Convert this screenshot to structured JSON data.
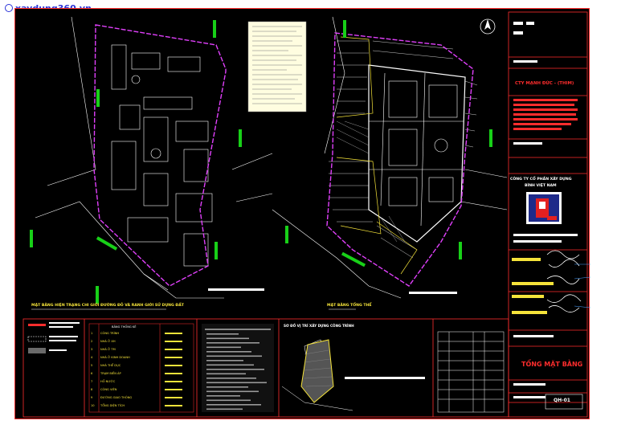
{
  "watermark": {
    "text": "xaydung360.vn",
    "icon": "circle-arrow-icon",
    "color": "#2a33d8"
  },
  "drawing": {
    "title_left": "MẶT BẰNG HIỆN TRẠNG CHI GIỚI ĐƯỜNG ĐỎ VÀ RANH GIỚI SỬ DỤNG ĐẤT",
    "title_right": "MẶT BẰNG TỔNG THỂ",
    "north_arrow": "north-arrow-icon"
  },
  "title_block": {
    "company": "CTY MẠNH ĐỨC - (THIM)",
    "designer": "CÔNG TY CỔ PHẦN XÂY DỰNG",
    "designer_line2": "BÌNH VIỆT NAM",
    "sheet_title": "TỔNG MẶT BẰNG",
    "sheet_no": "QH-01"
  },
  "legend_table": {
    "header": "BẢNG THỐNG KÊ",
    "rows": [
      {
        "no": "1",
        "name": "CÔNG TRÌNH"
      },
      {
        "no": "2",
        "name": "NHÀ Ở XH"
      },
      {
        "no": "3",
        "name": "NHÀ Ở TM"
      },
      {
        "no": "4",
        "name": "NHÀ Ở KINH DOANH"
      },
      {
        "no": "5",
        "name": "NHÀ THỂ DỤC"
      },
      {
        "no": "6",
        "name": "TRẠM BIẾN ÁP"
      },
      {
        "no": "7",
        "name": "HỒ NƯỚC"
      },
      {
        "no": "8",
        "name": "CÔNG VIÊN"
      },
      {
        "no": "9",
        "name": "ĐƯỜNG GIAO THÔNG"
      },
      {
        "no": "10",
        "name": "TỔNG DIỆN TÍCH"
      }
    ]
  },
  "location_map": {
    "title": "SƠ ĐỒ VỊ TRÍ XÂY DỰNG CÔNG TRÌNH"
  },
  "colors": {
    "boundary": "#e040fb",
    "green": "#18d018",
    "yellow": "#f5e33a",
    "red": "#ff2d2d",
    "white": "#ffffff"
  }
}
